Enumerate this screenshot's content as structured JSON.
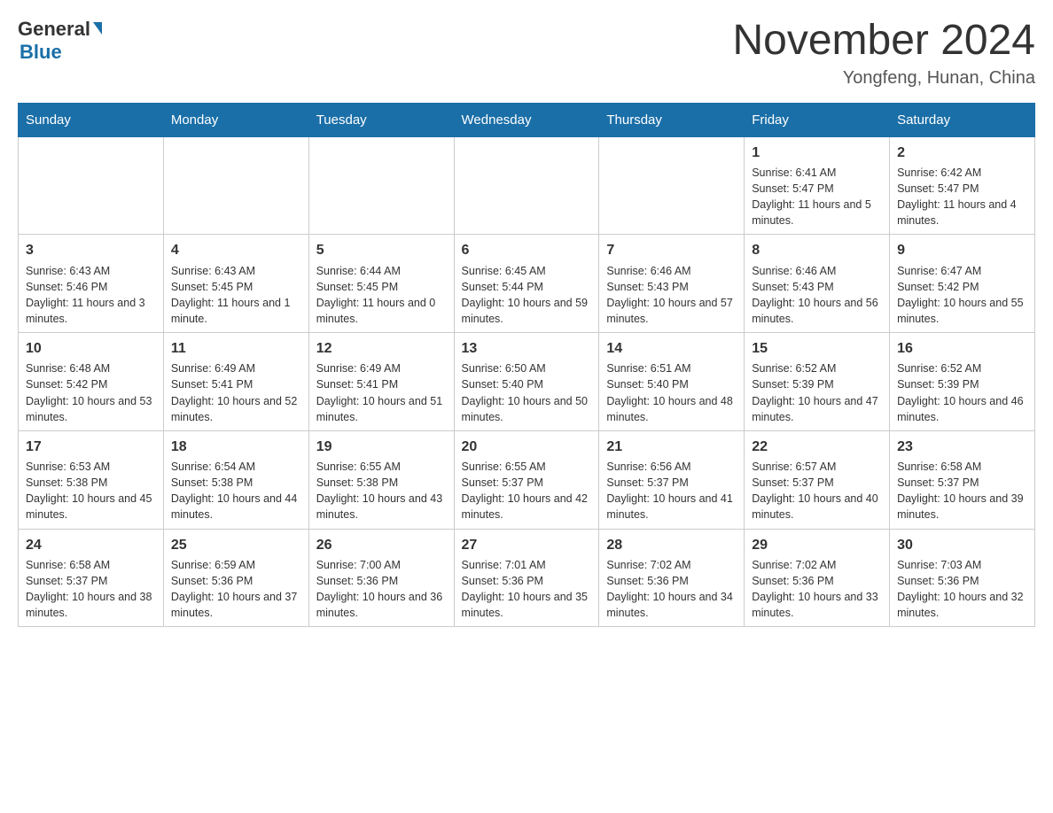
{
  "header": {
    "logo_general": "General",
    "logo_blue": "Blue",
    "month_title": "November 2024",
    "location": "Yongfeng, Hunan, China"
  },
  "days_of_week": [
    "Sunday",
    "Monday",
    "Tuesday",
    "Wednesday",
    "Thursday",
    "Friday",
    "Saturday"
  ],
  "weeks": [
    [
      {
        "day": "",
        "info": ""
      },
      {
        "day": "",
        "info": ""
      },
      {
        "day": "",
        "info": ""
      },
      {
        "day": "",
        "info": ""
      },
      {
        "day": "",
        "info": ""
      },
      {
        "day": "1",
        "info": "Sunrise: 6:41 AM\nSunset: 5:47 PM\nDaylight: 11 hours and 5 minutes."
      },
      {
        "day": "2",
        "info": "Sunrise: 6:42 AM\nSunset: 5:47 PM\nDaylight: 11 hours and 4 minutes."
      }
    ],
    [
      {
        "day": "3",
        "info": "Sunrise: 6:43 AM\nSunset: 5:46 PM\nDaylight: 11 hours and 3 minutes."
      },
      {
        "day": "4",
        "info": "Sunrise: 6:43 AM\nSunset: 5:45 PM\nDaylight: 11 hours and 1 minute."
      },
      {
        "day": "5",
        "info": "Sunrise: 6:44 AM\nSunset: 5:45 PM\nDaylight: 11 hours and 0 minutes."
      },
      {
        "day": "6",
        "info": "Sunrise: 6:45 AM\nSunset: 5:44 PM\nDaylight: 10 hours and 59 minutes."
      },
      {
        "day": "7",
        "info": "Sunrise: 6:46 AM\nSunset: 5:43 PM\nDaylight: 10 hours and 57 minutes."
      },
      {
        "day": "8",
        "info": "Sunrise: 6:46 AM\nSunset: 5:43 PM\nDaylight: 10 hours and 56 minutes."
      },
      {
        "day": "9",
        "info": "Sunrise: 6:47 AM\nSunset: 5:42 PM\nDaylight: 10 hours and 55 minutes."
      }
    ],
    [
      {
        "day": "10",
        "info": "Sunrise: 6:48 AM\nSunset: 5:42 PM\nDaylight: 10 hours and 53 minutes."
      },
      {
        "day": "11",
        "info": "Sunrise: 6:49 AM\nSunset: 5:41 PM\nDaylight: 10 hours and 52 minutes."
      },
      {
        "day": "12",
        "info": "Sunrise: 6:49 AM\nSunset: 5:41 PM\nDaylight: 10 hours and 51 minutes."
      },
      {
        "day": "13",
        "info": "Sunrise: 6:50 AM\nSunset: 5:40 PM\nDaylight: 10 hours and 50 minutes."
      },
      {
        "day": "14",
        "info": "Sunrise: 6:51 AM\nSunset: 5:40 PM\nDaylight: 10 hours and 48 minutes."
      },
      {
        "day": "15",
        "info": "Sunrise: 6:52 AM\nSunset: 5:39 PM\nDaylight: 10 hours and 47 minutes."
      },
      {
        "day": "16",
        "info": "Sunrise: 6:52 AM\nSunset: 5:39 PM\nDaylight: 10 hours and 46 minutes."
      }
    ],
    [
      {
        "day": "17",
        "info": "Sunrise: 6:53 AM\nSunset: 5:38 PM\nDaylight: 10 hours and 45 minutes."
      },
      {
        "day": "18",
        "info": "Sunrise: 6:54 AM\nSunset: 5:38 PM\nDaylight: 10 hours and 44 minutes."
      },
      {
        "day": "19",
        "info": "Sunrise: 6:55 AM\nSunset: 5:38 PM\nDaylight: 10 hours and 43 minutes."
      },
      {
        "day": "20",
        "info": "Sunrise: 6:55 AM\nSunset: 5:37 PM\nDaylight: 10 hours and 42 minutes."
      },
      {
        "day": "21",
        "info": "Sunrise: 6:56 AM\nSunset: 5:37 PM\nDaylight: 10 hours and 41 minutes."
      },
      {
        "day": "22",
        "info": "Sunrise: 6:57 AM\nSunset: 5:37 PM\nDaylight: 10 hours and 40 minutes."
      },
      {
        "day": "23",
        "info": "Sunrise: 6:58 AM\nSunset: 5:37 PM\nDaylight: 10 hours and 39 minutes."
      }
    ],
    [
      {
        "day": "24",
        "info": "Sunrise: 6:58 AM\nSunset: 5:37 PM\nDaylight: 10 hours and 38 minutes."
      },
      {
        "day": "25",
        "info": "Sunrise: 6:59 AM\nSunset: 5:36 PM\nDaylight: 10 hours and 37 minutes."
      },
      {
        "day": "26",
        "info": "Sunrise: 7:00 AM\nSunset: 5:36 PM\nDaylight: 10 hours and 36 minutes."
      },
      {
        "day": "27",
        "info": "Sunrise: 7:01 AM\nSunset: 5:36 PM\nDaylight: 10 hours and 35 minutes."
      },
      {
        "day": "28",
        "info": "Sunrise: 7:02 AM\nSunset: 5:36 PM\nDaylight: 10 hours and 34 minutes."
      },
      {
        "day": "29",
        "info": "Sunrise: 7:02 AM\nSunset: 5:36 PM\nDaylight: 10 hours and 33 minutes."
      },
      {
        "day": "30",
        "info": "Sunrise: 7:03 AM\nSunset: 5:36 PM\nDaylight: 10 hours and 32 minutes."
      }
    ]
  ]
}
